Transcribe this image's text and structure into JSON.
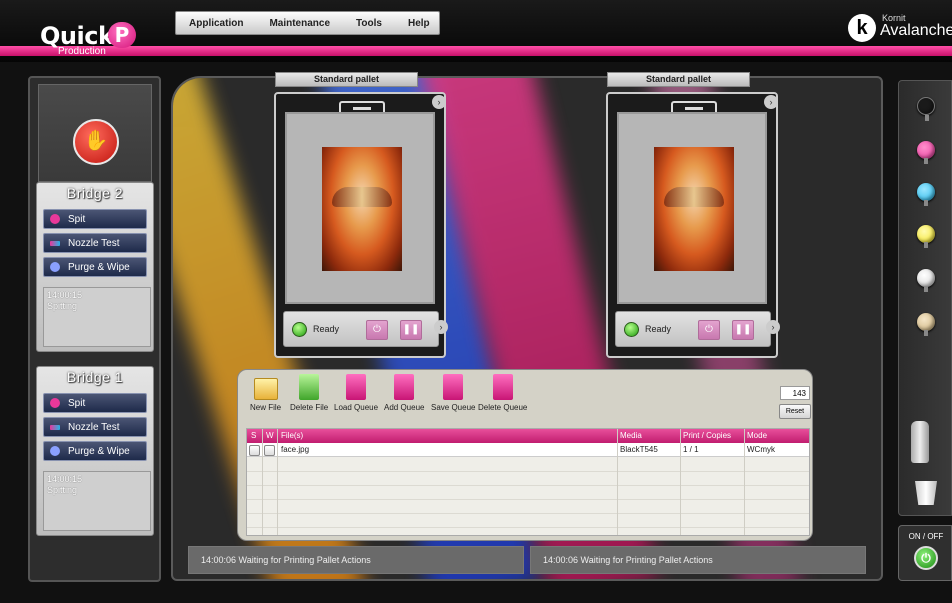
{
  "header": {
    "logo_text": "Quick",
    "logo_badge": "P",
    "logo_sub": "Production",
    "brand_small": "Kornit",
    "brand_big": "Avalanche",
    "menu": [
      "Application",
      "Maintenance",
      "Tools",
      "Help"
    ]
  },
  "bridges": [
    {
      "title": "Bridge 2",
      "buttons": [
        "Spit",
        "Nozzle Test",
        "Purge & Wipe"
      ],
      "log": [
        "14:00:15",
        "Spitting"
      ]
    },
    {
      "title": "Bridge 1",
      "buttons": [
        "Spit",
        "Nozzle Test",
        "Purge & Wipe"
      ],
      "log": [
        "14:00:15",
        "Spitting"
      ]
    }
  ],
  "pallets": [
    {
      "label": "Standard pallet",
      "status": "Ready"
    },
    {
      "label": "Standard pallet",
      "status": "Ready"
    }
  ],
  "queue": {
    "toolbar": [
      "New File",
      "Delete File",
      "Load Queue",
      "Add Queue",
      "Save Queue",
      "Delete Queue"
    ],
    "counter": "143",
    "reset_label": "Reset",
    "columns": [
      "S",
      "W",
      "File(s)",
      "Media",
      "Print / Copies",
      "Mode"
    ],
    "rows": [
      {
        "file": "face.jpg",
        "media": "BlackT545",
        "copies": "1 / 1",
        "mode": "WCmyk"
      }
    ]
  },
  "status_messages": [
    "14:00:06 Waiting for Printing Pallet Actions",
    "14:00:06 Waiting for Printing Pallet Actions"
  ],
  "inks": [
    {
      "name": "black-ink-icon",
      "color": "#1a1a1a"
    },
    {
      "name": "magenta-ink-icon",
      "color": "#e8389a"
    },
    {
      "name": "cyan-ink-icon",
      "color": "#22b6e8"
    },
    {
      "name": "yellow-ink-icon",
      "color": "#f2e21c"
    },
    {
      "name": "white-ink-icon",
      "color": "#e6e6e6"
    },
    {
      "name": "beige-ink-icon",
      "color": "#d6c29a"
    }
  ],
  "power": {
    "label": "ON / OFF"
  },
  "colors": {
    "accent": "#d4157a",
    "ready": "#1d9a0c"
  }
}
